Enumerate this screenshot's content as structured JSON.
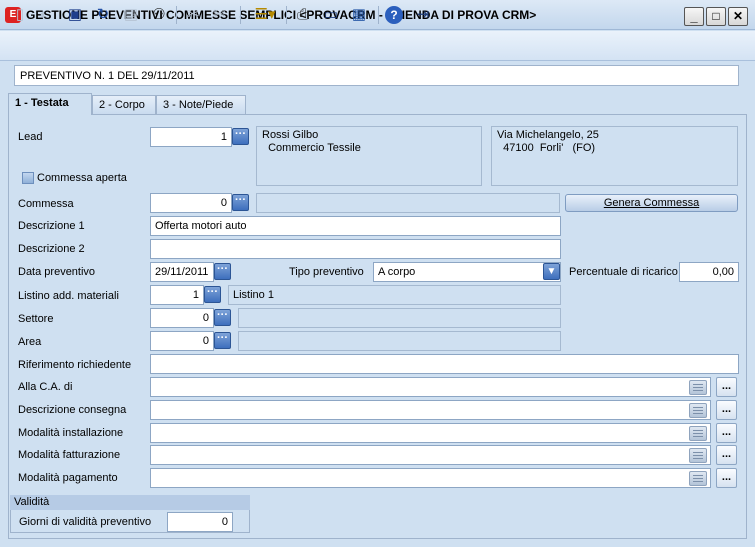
{
  "window": {
    "title": "GESTIONE PREVENTIVI COMMESSE SEMPLICI <PROVACRM - AZIENDA DI PROVA CRM>",
    "app_icon": "E",
    "minimize": "_",
    "maximize": "□",
    "close": "✕"
  },
  "toolbar": {
    "icons": [
      "new-icon",
      "undo-icon",
      "save-icon",
      "refresh-icon",
      "delete-icon",
      "search-binoculars-icon",
      "cut-icon",
      "copy-icon",
      "list-options-icon",
      "print-icon",
      "monitor-preview-icon",
      "export-icon",
      "help-icon",
      "exit-icon"
    ]
  },
  "document_header": "PREVENTIVO N. 1 DEL 29/11/2011",
  "tabs": [
    {
      "label": "1 - Testata"
    },
    {
      "label": "2 - Corpo"
    },
    {
      "label": "3 - Note/Piede"
    }
  ],
  "form": {
    "lead": {
      "label": "Lead",
      "value": "1",
      "name_block": "Rossi Gilbo\n  Commercio Tessile",
      "address_block": "Via Michelangelo, 25\n  47100  Forli'   (FO)"
    },
    "commessa_aperta": {
      "label": "Commessa aperta"
    },
    "commessa": {
      "label": "Commessa",
      "value": "0",
      "desc": ""
    },
    "genera_commessa": "Genera Commessa",
    "descrizione1": {
      "label": "Descrizione 1",
      "value": "Offerta motori auto"
    },
    "descrizione2": {
      "label": "Descrizione 2",
      "value": ""
    },
    "data_preventivo": {
      "label": "Data preventivo",
      "value": "29/11/2011"
    },
    "tipo_preventivo": {
      "label": "Tipo preventivo",
      "value": "A corpo"
    },
    "percentuale_ricarico": {
      "label": "Percentuale di ricarico",
      "value": "0,00"
    },
    "listino": {
      "label": "Listino add. materiali",
      "value": "1",
      "desc": "Listino 1"
    },
    "settore": {
      "label": "Settore",
      "value": "0",
      "desc": ""
    },
    "area": {
      "label": "Area",
      "value": "0",
      "desc": ""
    },
    "riferimento": {
      "label": "Riferimento richiedente",
      "value": ""
    },
    "alla_ca": {
      "label": "Alla C.A. di",
      "value": ""
    },
    "descrizione_consegna": {
      "label": "Descrizione consegna",
      "value": ""
    },
    "modalita_installazione": {
      "label": "Modalità installazione",
      "value": ""
    },
    "modalita_fatturazione": {
      "label": "Modalità fatturazione",
      "value": ""
    },
    "modalita_pagamento": {
      "label": "Modalità pagamento",
      "value": ""
    },
    "ellipsis": "..."
  },
  "validita": {
    "title": "Validità",
    "giorni_label": "Giorni di validità preventivo",
    "giorni_value": "0"
  }
}
